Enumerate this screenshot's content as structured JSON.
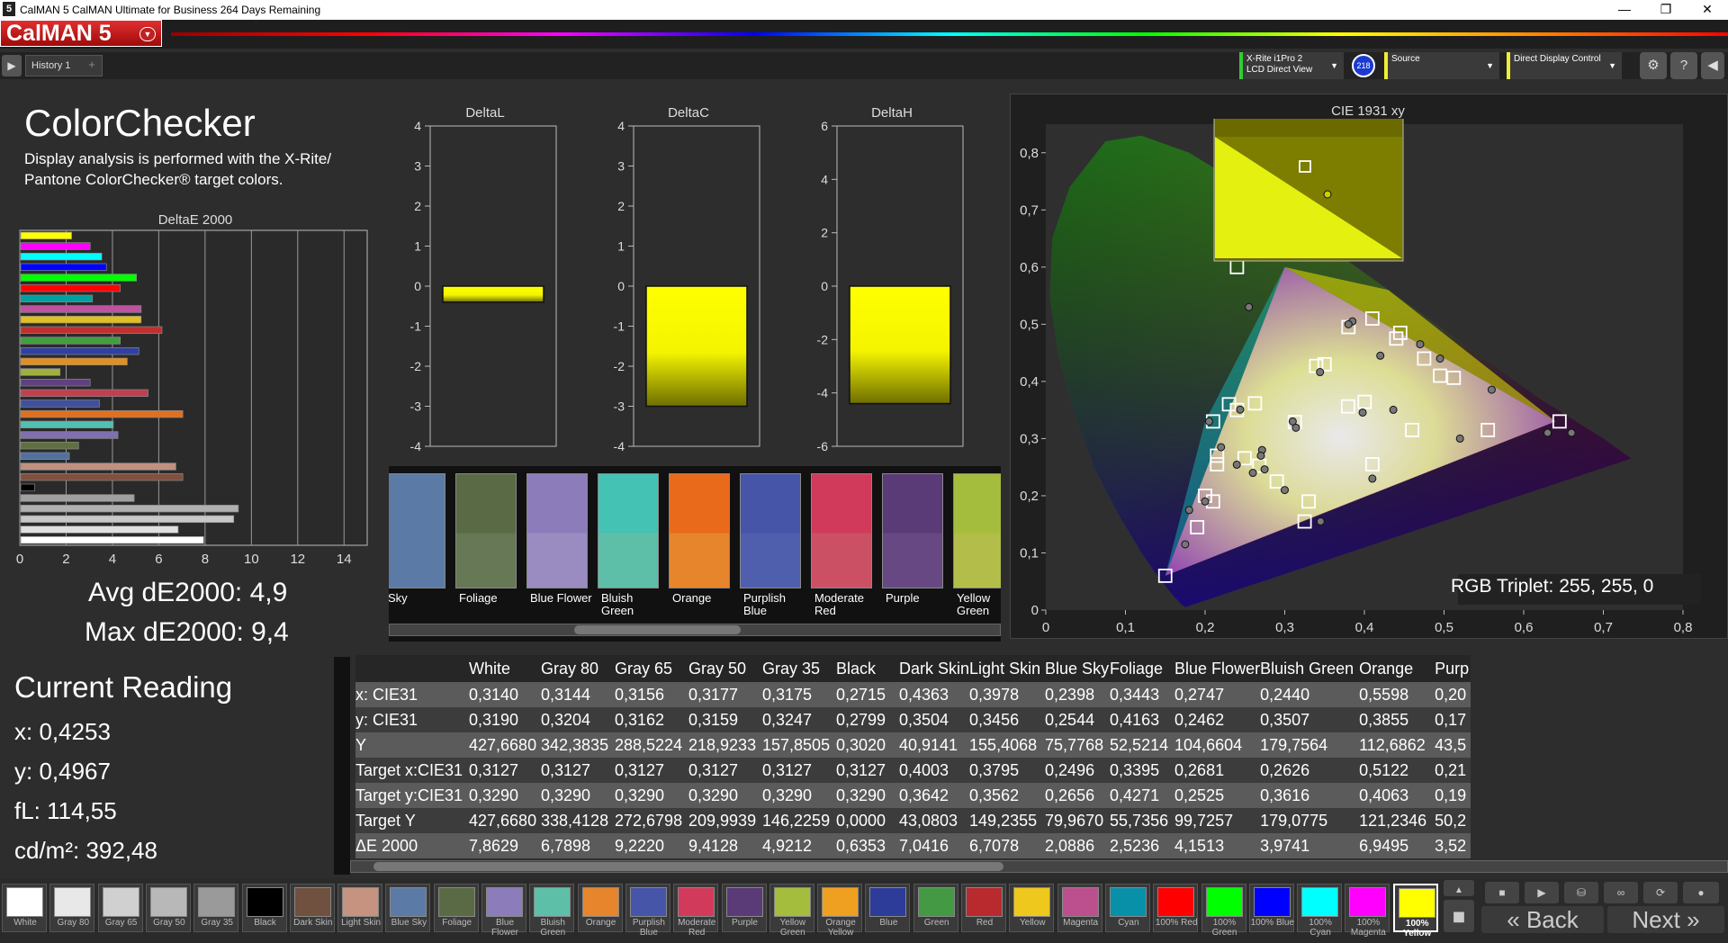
{
  "window": {
    "title": "CalMAN 5 CalMAN Ultimate for Business 264 Days Remaining",
    "app_icon": "5",
    "minimize": "—",
    "restore": "❐",
    "close": "✕"
  },
  "logo": {
    "text": "CalMAN 5"
  },
  "tabs": {
    "items": [
      "History 1"
    ],
    "add": "+"
  },
  "devices": {
    "meter_line1": "X-Rite i1Pro 2",
    "meter_line2": "LCD Direct View",
    "meter_badge": "218",
    "source": "Source",
    "display": "Direct Display Control"
  },
  "page": {
    "title": "ColorChecker",
    "description": "Display analysis is performed with the X-Rite/ Pantone ColorChecker® target colors."
  },
  "stats": {
    "avg": "Avg dE2000: 4,9",
    "max": "Max dE2000: 9,4"
  },
  "current_reading": {
    "title": "Current Reading",
    "x": "x: 0,4253",
    "y": "y: 0,4967",
    "fl": "fL: 114,55",
    "cdm2": "cd/m²: 392,48"
  },
  "chart_data": [
    {
      "type": "bar",
      "title": "DeltaE 2000",
      "orientation": "horizontal",
      "xlim": [
        0,
        15
      ],
      "xticks": [
        "0",
        "2",
        "4",
        "6",
        "8",
        "10",
        "12",
        "14"
      ],
      "bars": [
        {
          "color": "#ffff00",
          "value": 2.2
        },
        {
          "color": "#ff00ff",
          "value": 3.0
        },
        {
          "color": "#00ffff",
          "value": 3.5
        },
        {
          "color": "#0000ff",
          "value": 3.7
        },
        {
          "color": "#00ff00",
          "value": 5.0
        },
        {
          "color": "#ff0000",
          "value": 4.3
        },
        {
          "color": "#00a0a0",
          "value": 3.1
        },
        {
          "color": "#c050a0",
          "value": 5.2
        },
        {
          "color": "#e0c020",
          "value": 5.2
        },
        {
          "color": "#c03030",
          "value": 6.1
        },
        {
          "color": "#40a040",
          "value": 4.3
        },
        {
          "color": "#3040a0",
          "value": 5.1
        },
        {
          "color": "#e09020",
          "value": 4.6
        },
        {
          "color": "#a0b040",
          "value": 1.7
        },
        {
          "color": "#604080",
          "value": 3.0
        },
        {
          "color": "#c04050",
          "value": 5.5
        },
        {
          "color": "#4050a0",
          "value": 3.4
        },
        {
          "color": "#e07020",
          "value": 7.0
        },
        {
          "color": "#50c0b0",
          "value": 4.0
        },
        {
          "color": "#8070b0",
          "value": 4.2
        },
        {
          "color": "#607040",
          "value": 2.5
        },
        {
          "color": "#5070a0",
          "value": 2.1
        },
        {
          "color": "#c09080",
          "value": 6.7
        },
        {
          "color": "#805040",
          "value": 7.0
        },
        {
          "color": "#000000",
          "value": 0.6
        },
        {
          "color": "#a0a0a0",
          "value": 4.9
        },
        {
          "color": "#b0b0b0",
          "value": 9.4
        },
        {
          "color": "#c8c8c8",
          "value": 9.2
        },
        {
          "color": "#e0e0e0",
          "value": 6.8
        },
        {
          "color": "#ffffff",
          "value": 7.9
        }
      ]
    },
    {
      "type": "bar",
      "title": "DeltaL",
      "ylim": [
        -4,
        4
      ],
      "yticks": [
        "4",
        "3",
        "2",
        "1",
        "0",
        "-1",
        "-2",
        "-3",
        "-4"
      ],
      "value": -0.4
    },
    {
      "type": "bar",
      "title": "DeltaC",
      "ylim": [
        -4,
        4
      ],
      "yticks": [
        "4",
        "3",
        "2",
        "1",
        "0",
        "-1",
        "-2",
        "-3",
        "-4"
      ],
      "value": -3.0
    },
    {
      "type": "bar",
      "title": "DeltaH",
      "ylim": [
        -6,
        6
      ],
      "yticks": [
        "6",
        "4",
        "2",
        "0",
        "-2",
        "-4",
        "-6"
      ],
      "value": -4.4
    },
    {
      "type": "scatter",
      "title": "CIE 1931 xy",
      "xlim": [
        0,
        0.8
      ],
      "ylim": [
        0,
        0.85
      ],
      "xticks": [
        "0",
        "0,1",
        "0,2",
        "0,3",
        "0,4",
        "0,5",
        "0,6",
        "0,7",
        "0,8"
      ],
      "yticks": [
        "0,8",
        "0,7",
        "0,6",
        "0,5",
        "0,4",
        "0,3",
        "0,2",
        "0,1",
        "0"
      ],
      "targets": [
        [
          0.3127,
          0.329
        ],
        [
          0.4003,
          0.3642
        ],
        [
          0.3795,
          0.3562
        ],
        [
          0.2496,
          0.2656
        ],
        [
          0.3395,
          0.4271
        ],
        [
          0.2681,
          0.2525
        ],
        [
          0.2626,
          0.3616
        ],
        [
          0.5122,
          0.4063
        ],
        [
          0.21,
          0.19
        ],
        [
          0.46,
          0.315
        ],
        [
          0.29,
          0.225
        ],
        [
          0.38,
          0.495
        ],
        [
          0.475,
          0.44
        ],
        [
          0.19,
          0.145
        ],
        [
          0.24,
          0.6
        ],
        [
          0.645,
          0.33
        ],
        [
          0.215,
          0.27
        ],
        [
          0.41,
          0.255
        ],
        [
          0.325,
          0.155
        ],
        [
          0.41,
          0.51
        ],
        [
          0.555,
          0.315
        ],
        [
          0.33,
          0.19
        ],
        [
          0.21,
          0.33
        ],
        [
          0.495,
          0.41
        ],
        [
          0.15,
          0.06
        ],
        [
          0.35,
          0.43
        ],
        [
          0.24,
          0.35
        ],
        [
          0.445,
          0.485
        ],
        [
          0.23,
          0.36
        ],
        [
          0.2,
          0.2
        ],
        [
          0.44,
          0.475
        ],
        [
          0.215,
          0.255
        ]
      ],
      "measured": [
        [
          0.314,
          0.319
        ],
        [
          0.4363,
          0.3504
        ],
        [
          0.3978,
          0.3456
        ],
        [
          0.2398,
          0.2544
        ],
        [
          0.3443,
          0.4163
        ],
        [
          0.2747,
          0.2462
        ],
        [
          0.244,
          0.3507
        ],
        [
          0.5598,
          0.3855
        ],
        [
          0.66,
          0.31
        ],
        [
          0.18,
          0.175
        ],
        [
          0.2715,
          0.2799
        ],
        [
          0.41,
          0.23
        ],
        [
          0.27,
          0.27
        ],
        [
          0.3,
          0.21
        ],
        [
          0.345,
          0.155
        ],
        [
          0.63,
          0.31
        ],
        [
          0.205,
          0.33
        ],
        [
          0.2,
          0.19
        ],
        [
          0.47,
          0.465
        ],
        [
          0.385,
          0.505
        ],
        [
          0.52,
          0.3
        ],
        [
          0.26,
          0.24
        ],
        [
          0.175,
          0.115
        ],
        [
          0.22,
          0.285
        ],
        [
          0.255,
          0.53
        ],
        [
          0.42,
          0.445
        ],
        [
          0.495,
          0.44
        ],
        [
          0.225,
          0.62
        ],
        [
          0.38,
          0.5
        ],
        [
          0.31,
          0.33
        ]
      ],
      "current_target": [
        0.4253,
        0.4967
      ],
      "rgb_triplet": "RGB Triplet: 255, 255, 0"
    }
  ],
  "swatches": [
    {
      "label": "Sky",
      "color": "#5b7ba6"
    },
    {
      "label": "Foliage",
      "color": "#5a6a45"
    },
    {
      "label": "Blue Flower",
      "color": "#8c7cba"
    },
    {
      "label": "Bluish Green",
      "color": "#44c2b3"
    },
    {
      "label": "Orange",
      "color": "#ea6a1c"
    },
    {
      "label": "Purplish Blue",
      "color": "#4655a8"
    },
    {
      "label": "Moderate Red",
      "color": "#d13a5a"
    },
    {
      "label": "Purple",
      "color": "#5b3a78"
    },
    {
      "label": "Yellow Green",
      "color": "#a4bd3c"
    },
    {
      "label": "",
      "color": "#f0a020"
    }
  ],
  "swatch_lower": [
    "#5b7ba6",
    "#667855",
    "#9a8cc0",
    "#5ebfa8",
    "#e7852c",
    "#4f5fae",
    "#cb5064",
    "#684883",
    "#b2bd4a",
    "#f0a020"
  ],
  "table": {
    "columns": [
      "",
      "White",
      "Gray 80",
      "Gray 65",
      "Gray 50",
      "Gray 35",
      "Black",
      "Dark Skin",
      "Light Skin",
      "Blue Sky",
      "Foliage",
      "Blue Flower",
      "Bluish Green",
      "Orange",
      "Purp"
    ],
    "rows": [
      [
        "x: CIE31",
        "0,3140",
        "0,3144",
        "0,3156",
        "0,3177",
        "0,3175",
        "0,2715",
        "0,4363",
        "0,3978",
        "0,2398",
        "0,3443",
        "0,2747",
        "0,2440",
        "0,5598",
        "0,20"
      ],
      [
        "y: CIE31",
        "0,3190",
        "0,3204",
        "0,3162",
        "0,3159",
        "0,3247",
        "0,2799",
        "0,3504",
        "0,3456",
        "0,2544",
        "0,4163",
        "0,2462",
        "0,3507",
        "0,3855",
        "0,17"
      ],
      [
        "Y",
        "427,6680",
        "342,3835",
        "288,5224",
        "218,9233",
        "157,8505",
        "0,3020",
        "40,9141",
        "155,4068",
        "75,7768",
        "52,5214",
        "104,6604",
        "179,7564",
        "112,6862",
        "43,5"
      ],
      [
        "Target x:CIE31",
        "0,3127",
        "0,3127",
        "0,3127",
        "0,3127",
        "0,3127",
        "0,3127",
        "0,4003",
        "0,3795",
        "0,2496",
        "0,3395",
        "0,2681",
        "0,2626",
        "0,5122",
        "0,21"
      ],
      [
        "Target y:CIE31",
        "0,3290",
        "0,3290",
        "0,3290",
        "0,3290",
        "0,3290",
        "0,3290",
        "0,3642",
        "0,3562",
        "0,2656",
        "0,4271",
        "0,2525",
        "0,3616",
        "0,4063",
        "0,19"
      ],
      [
        "Target Y",
        "427,6680",
        "338,4128",
        "272,6798",
        "209,9939",
        "146,2259",
        "0,0000",
        "43,0803",
        "149,2355",
        "79,9670",
        "55,7356",
        "99,7257",
        "179,0775",
        "121,2346",
        "50,2"
      ],
      [
        "ΔE 2000",
        "7,8629",
        "6,7898",
        "9,2220",
        "9,4128",
        "4,9212",
        "0,6353",
        "7,0416",
        "6,7078",
        "2,0886",
        "2,5236",
        "4,1513",
        "3,9741",
        "6,9495",
        "3,52"
      ]
    ]
  },
  "bottom_swatches": [
    {
      "label": "White",
      "color": "#ffffff"
    },
    {
      "label": "Gray 80",
      "color": "#e8e8e8"
    },
    {
      "label": "Gray 65",
      "color": "#d0d0d0"
    },
    {
      "label": "Gray 50",
      "color": "#b8b8b8"
    },
    {
      "label": "Gray 35",
      "color": "#9a9a9a"
    },
    {
      "label": "Black",
      "color": "#000000"
    },
    {
      "label": "Dark Skin",
      "color": "#70503e"
    },
    {
      "label": "Light Skin",
      "color": "#c5937f"
    },
    {
      "label": "Blue Sky",
      "color": "#5b7ba6"
    },
    {
      "label": "Foliage",
      "color": "#5a6a45"
    },
    {
      "label": "Blue Flower",
      "color": "#8c7cba"
    },
    {
      "label": "Bluish Green",
      "color": "#5ebfa8"
    },
    {
      "label": "Orange",
      "color": "#e7852c"
    },
    {
      "label": "Purplish Blue",
      "color": "#4655a8"
    },
    {
      "label": "Moderate Red",
      "color": "#d13a5a"
    },
    {
      "label": "Purple",
      "color": "#5b3a78"
    },
    {
      "label": "Yellow Green",
      "color": "#a4bd3c"
    },
    {
      "label": "Orange Yellow",
      "color": "#f0a020"
    },
    {
      "label": "Blue",
      "color": "#2c3c98"
    },
    {
      "label": "Green",
      "color": "#449a44"
    },
    {
      "label": "Red",
      "color": "#b82a2e"
    },
    {
      "label": "Yellow",
      "color": "#eec81c"
    },
    {
      "label": "Magenta",
      "color": "#bc508e"
    },
    {
      "label": "Cyan",
      "color": "#0890a8"
    },
    {
      "label": "100% Red",
      "color": "#ff0000"
    },
    {
      "label": "100% Green",
      "color": "#00ff00"
    },
    {
      "label": "100% Blue",
      "color": "#0000ff"
    },
    {
      "label": "100% Cyan",
      "color": "#00ffff"
    },
    {
      "label": "100% Magenta",
      "color": "#ff00ff"
    },
    {
      "label": "100% Yellow",
      "color": "#ffff00"
    }
  ],
  "nav": {
    "back": "Back",
    "next": "Next"
  }
}
